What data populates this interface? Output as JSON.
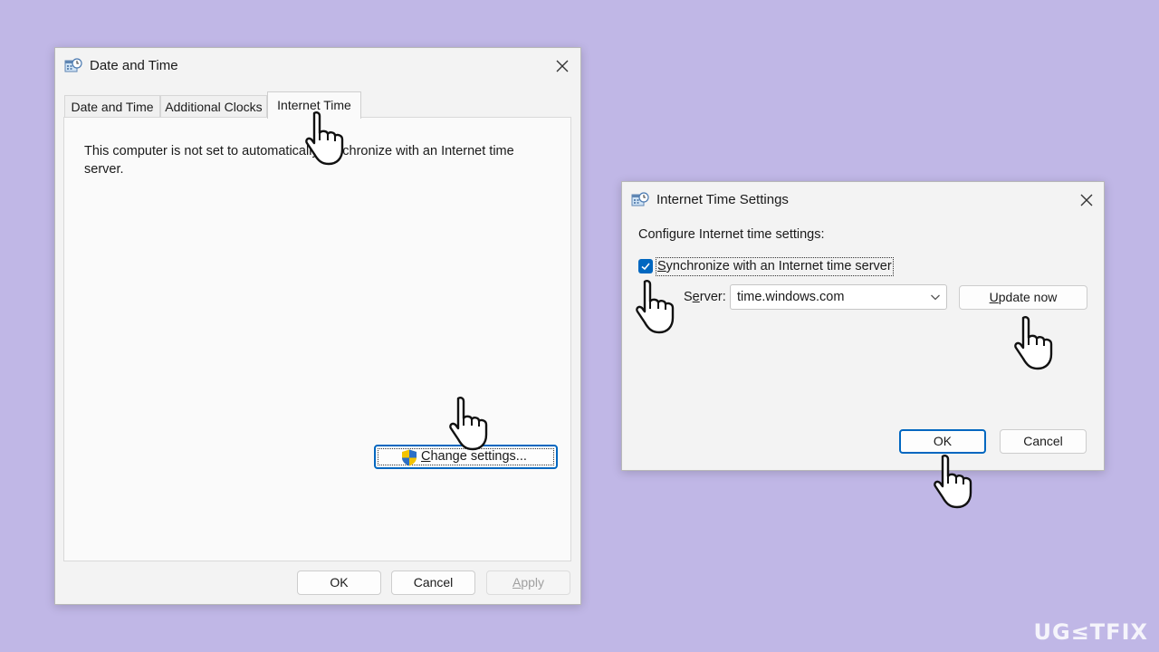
{
  "window_date_time": {
    "title": "Date and Time",
    "tabs": [
      {
        "label": "Date and Time"
      },
      {
        "label": "Additional Clocks"
      },
      {
        "label": "Internet Time"
      }
    ],
    "message": "This computer is not set to automatically synchronize with an Internet time server.",
    "change_settings_first": "C",
    "change_settings_rest": "hange settings...",
    "ok_label": "OK",
    "cancel_label": "Cancel",
    "apply_first": "A",
    "apply_rest": "pply"
  },
  "window_internet_time": {
    "title": "Internet Time Settings",
    "configure_label": "Configure Internet time settings:",
    "sync_checked": true,
    "sync_first": "S",
    "sync_rest": "ynchronize with an Internet time server",
    "server_label_pre": "S",
    "server_label_acc": "e",
    "server_label_post": "rver:",
    "server_value": "time.windows.com",
    "update_first": "U",
    "update_rest": "pdate now",
    "ok_label": "OK",
    "cancel_label": "Cancel"
  },
  "icons": {
    "window_icon": "date-time-icon",
    "close": "close-icon",
    "shield": "uac-shield-icon",
    "cursor": "hand-pointer-icon"
  },
  "colors": {
    "background": "#c0b7e6",
    "accent": "#0067c0"
  },
  "watermark": "UG≤TFIX"
}
